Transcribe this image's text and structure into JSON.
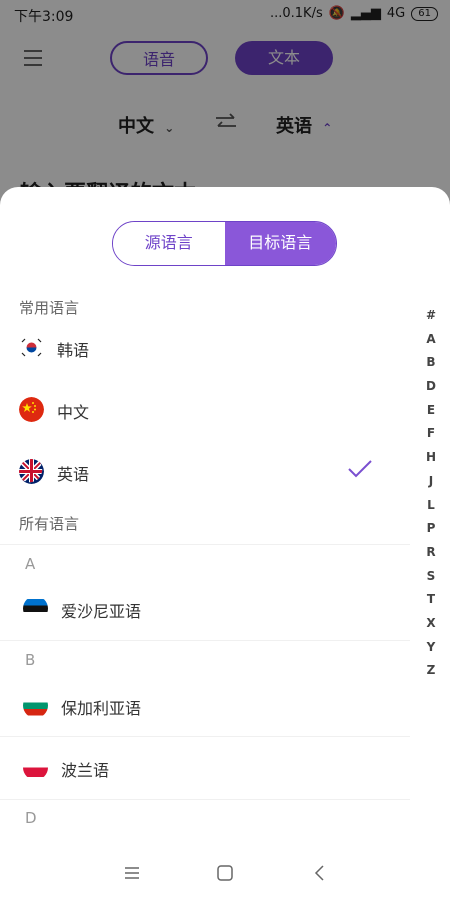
{
  "status": {
    "time": "下午3:09",
    "net": "...0.1K/s",
    "signal": "4G",
    "battery": "61"
  },
  "topbar": {
    "mode_voice": "语音",
    "mode_text": "文本"
  },
  "lang_selector": {
    "from": "中文",
    "to": "英语"
  },
  "background_text": "输入要翻译的文本",
  "sheet": {
    "seg_source": "源语言",
    "seg_target": "目标语言",
    "common_label": "常用语言",
    "common": [
      {
        "name": "韩语",
        "flag": "korea-flag-icon"
      },
      {
        "name": "中文",
        "flag": "china-flag-icon"
      },
      {
        "name": "英语",
        "flag": "uk-flag-icon",
        "selected": true
      }
    ],
    "all_label": "所有语言",
    "groups": [
      {
        "letter": "A",
        "items": [
          {
            "name": "爱沙尼亚语",
            "flag": "estonia-flag-icon"
          }
        ]
      },
      {
        "letter": "B",
        "items": [
          {
            "name": "保加利亚语",
            "flag": "bulgaria-flag-icon"
          },
          {
            "name": "波兰语",
            "flag": "poland-flag-icon"
          }
        ]
      },
      {
        "letter": "D",
        "items": []
      }
    ],
    "index": [
      "#",
      "A",
      "B",
      "D",
      "E",
      "F",
      "H",
      "J",
      "L",
      "P",
      "R",
      "S",
      "T",
      "X",
      "Y",
      "Z"
    ]
  },
  "colors": {
    "accent": "#6e43c8",
    "accent_light": "#8a57d9"
  }
}
